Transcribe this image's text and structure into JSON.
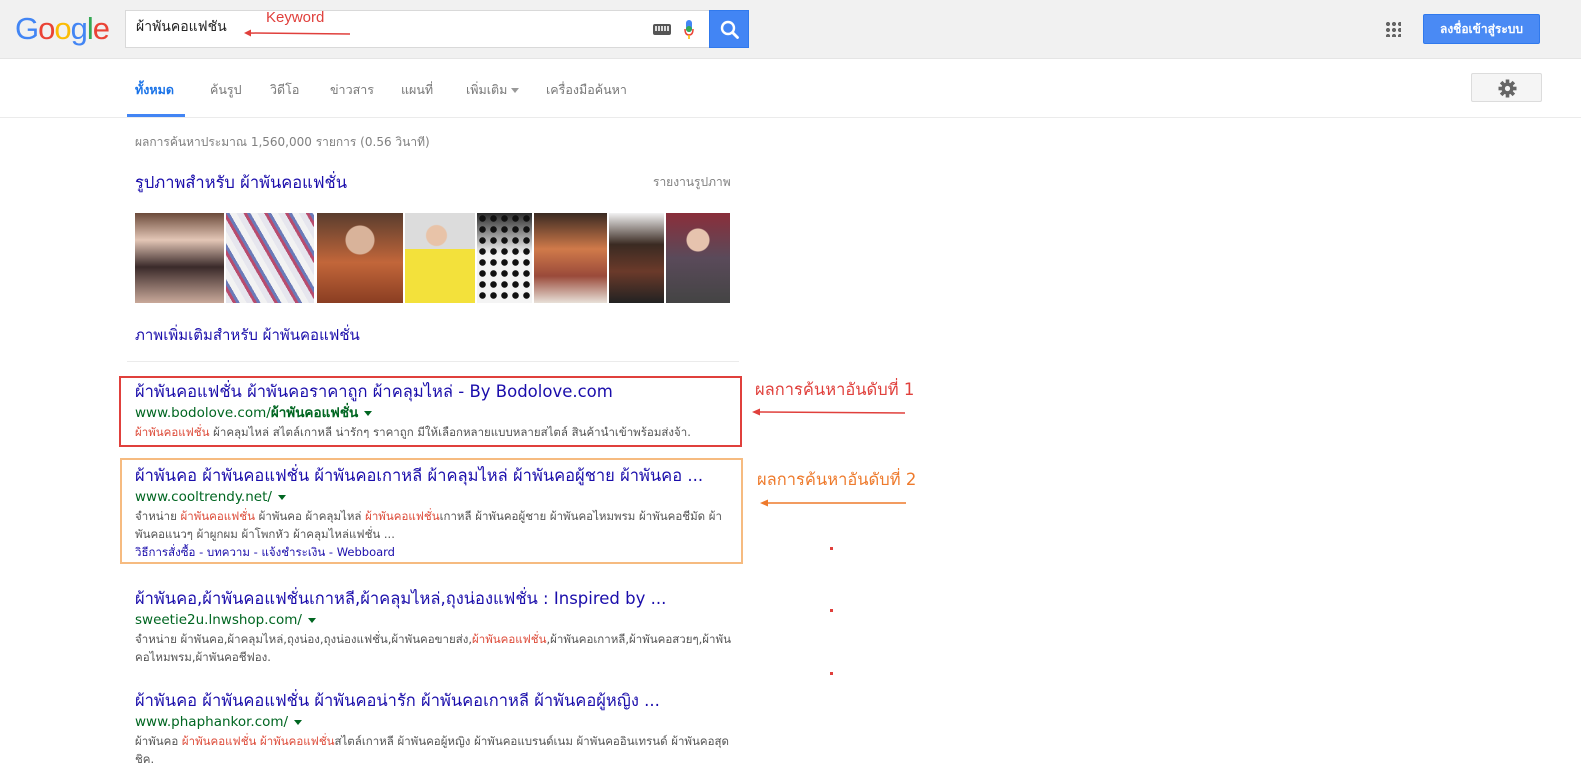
{
  "header": {
    "logo_letters": [
      "G",
      "o",
      "o",
      "g",
      "l",
      "e"
    ],
    "search_value": "ผ้าพันคอแฟชั่น",
    "signin_label": "ลงชื่อเข้าสู่ระบบ"
  },
  "nav": {
    "items": [
      "ทั้งหมด",
      "ค้นรูป",
      "วิดีโอ",
      "ข่าวสาร",
      "แผนที่",
      "เพิ่มเติม",
      "เครื่องมือค้นหา"
    ],
    "active": "ทั้งหมด"
  },
  "stats": "ผลการค้นหาประมาณ 1,560,000 รายการ (0.56 วินาที)",
  "images": {
    "header": "รูปภาพสำหรับ ผ้าพันคอแฟชั่น",
    "report": "รายงานรูปภาพ",
    "more": "ภาพเพิ่มเติมสำหรับ ผ้าพันคอแฟชั่น"
  },
  "results": [
    {
      "title": "ผ้าพันคอแฟชั่น ผ้าพันคอราคาถูก ผ้าคลุมไหล่ - By Bodolove.com",
      "url_plain": "www.bodolove.com/",
      "url_bold": "ผ้าพันคอแฟชั่น",
      "snippet_parts": [
        {
          "t": "ผ้าพันคอแฟชั่น",
          "em": true
        },
        {
          "t": " ผ้าคลุมไหล่ สไตล์เกาหลี น่ารักๆ ราคาถูก มีให้เลือกหลายแบบหลายสไตล์ สินค้านำเข้าพร้อมส่งจ้า.",
          "em": false
        }
      ]
    },
    {
      "title": "ผ้าพันคอ ผ้าพันคอแฟชั่น ผ้าพันคอเกาหลี ผ้าคลุมไหล่ ผ้าพันคอผู้ชาย ผ้าพันคอ ...",
      "url_plain": "www.cooltrendy.net/",
      "url_bold": "",
      "snippet_parts": [
        {
          "t": "จำหน่าย ",
          "em": false
        },
        {
          "t": "ผ้าพันคอแฟชั่น",
          "em": true
        },
        {
          "t": " ผ้าพันคอ ผ้าคลุมไหล่ ",
          "em": false
        },
        {
          "t": "ผ้าพันคอแฟชั่น",
          "em": true
        },
        {
          "t": "เกาหลี ผ้าพันคอผู้ชาย ผ้าพันคอไหมพรม ผ้าพันคอชีมัด ผ้าพันคอแนวๆ ผ้าผูกผม ผ้าโพกหัว ผ้าคลุมไหล่แฟชั่น ...",
          "em": false
        }
      ],
      "sitelinks": [
        "วิธีการสั่งซื้อ",
        "บทความ",
        "แจ้งชำระเงิน",
        "Webboard"
      ]
    },
    {
      "title": "ผ้าพันคอ,ผ้าพันคอแฟชั่นเกาหลี,ผ้าคลุมไหล่,ถุงน่องแฟชั่น : Inspired by ...",
      "url_plain": "sweetie2u.lnwshop.com/",
      "url_bold": "",
      "snippet_parts": [
        {
          "t": "จำหน่าย ผ้าพันคอ,ผ้าคลุมไหล่,ถุงน่อง,ถุงน่องแฟชั่น,ผ้าพันคอขายส่ง,",
          "em": false
        },
        {
          "t": "ผ้าพันคอแฟชั่น",
          "em": true
        },
        {
          "t": ",ผ้าพันคอเกาหลี,ผ้าพันคอสวยๆ,ผ้าพันคอไหมพรม,ผ้าพันคอชีฟอง.",
          "em": false
        }
      ]
    },
    {
      "title": "ผ้าพันคอ ผ้าพันคอแฟชั่น ผ้าพันคอน่ารัก ผ้าพันคอเกาหลี ผ้าพันคอผู้หญิง ...",
      "url_plain": "www.phaphankor.com/",
      "url_bold": "",
      "snippet_parts": [
        {
          "t": "ผ้าพันคอ ",
          "em": false
        },
        {
          "t": "ผ้าพันคอแฟชั่น",
          "em": true
        },
        {
          "t": " ",
          "em": false
        },
        {
          "t": "ผ้าพันคอแฟชั่น",
          "em": true
        },
        {
          "t": "สไตล์เกาหลี ผ้าพันคอผู้หญิง ผ้าพันคอแบรนด์เนม ผ้าพันคออินเทรนด์ ผ้าพันคอสุดชิค.",
          "em": false
        }
      ]
    }
  ],
  "annotations": {
    "keyword": "Keyword",
    "rank1": "ผลการค้นหาอันดับที่ 1",
    "rank2": "ผลการค้นหาอันดับที่ 2"
  },
  "colors": {
    "google_blue": "#4285f4",
    "link": "#1a0dab",
    "url_green": "#006621",
    "annotation_red": "#e0403c",
    "annotation_orange": "#ee7a2c"
  },
  "icons": [
    "keyboard-icon",
    "microphone-icon",
    "search-icon",
    "apps-grid-icon",
    "gear-icon",
    "dropdown-arrow-icon"
  ]
}
